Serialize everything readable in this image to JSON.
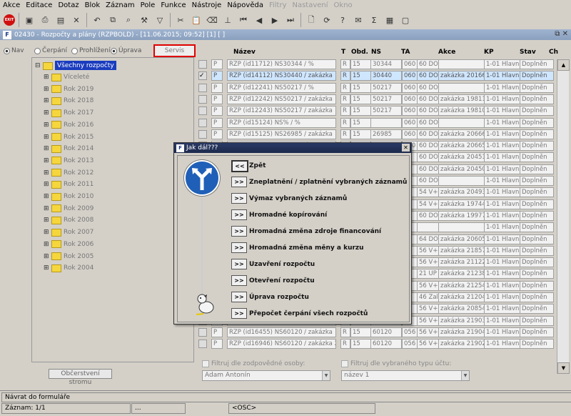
{
  "menu": {
    "items": [
      "Akce",
      "Editace",
      "Dotaz",
      "Blok",
      "Záznam",
      "Pole",
      "Funkce",
      "Nástroje",
      "Nápověda",
      "Filtry",
      "Nastavení",
      "Okno"
    ]
  },
  "toolbar": {
    "exit_label": "EXIT"
  },
  "window": {
    "title": "02430 - Rozpočty a plány (RZPBOLD) - [11.06.2015; 09:52]  [1]  [ ]",
    "logo": "F"
  },
  "left": {
    "radios": [
      "Nav",
      "Čerpání",
      "Prohlížení",
      "Úprava"
    ],
    "servis_label": "Servis",
    "tree_root": "Všechny rozpočty",
    "tree_items": [
      "Víceleté",
      "Rok 2019",
      "Rok 2018",
      "Rok 2017",
      "Rok 2016",
      "Rok 2015",
      "Rok 2014",
      "Rok 2013",
      "Rok 2012",
      "Rok 2011",
      "Rok 2010",
      "Rok 2009",
      "Rok 2008",
      "Rok 2007",
      "Rok 2006",
      "Rok 2005",
      "Rok 2004"
    ],
    "refresh_label": "Občerstvení stromu"
  },
  "grid": {
    "headers": [
      "Název",
      "T",
      "Obd.",
      "NS",
      "TA",
      "Akce",
      "KP",
      "Stav",
      "Ch"
    ],
    "rows": [
      {
        "p": "P",
        "nazev": "RZP (id11712) NS30344 / %",
        "t": "R",
        "obd": "15",
        "ns": "30344",
        "ta": "060",
        "ta2": "60 DO",
        "akce": "",
        "kp": "1-01 Hlavní",
        "stav": "Doplněn"
      },
      {
        "p": "P",
        "nazev": "RZP (id14112) NS30440 / zakázka",
        "t": "R",
        "obd": "15",
        "ns": "30440",
        "ta": "060",
        "ta2": "60 DO",
        "akce": "zakázka 20166",
        "kp": "1-01 Hlavní",
        "stav": "Doplněn"
      },
      {
        "p": "P",
        "nazev": "RZP (id12241) NS50217 / %",
        "t": "R",
        "obd": "15",
        "ns": "50217",
        "ta": "060",
        "ta2": "60 DO",
        "akce": "",
        "kp": "1-01 Hlavní",
        "stav": "Doplněn"
      },
      {
        "p": "P",
        "nazev": "RZP (id12242) NS50217 / zakázka",
        "t": "R",
        "obd": "15",
        "ns": "50217",
        "ta": "060",
        "ta2": "60 DO",
        "akce": "zakázka 19811",
        "kp": "1-01 Hlavní",
        "stav": "Doplněn"
      },
      {
        "p": "P",
        "nazev": "RZP (id12243) NS50217 / zakázka",
        "t": "R",
        "obd": "15",
        "ns": "50217",
        "ta": "060",
        "ta2": "60 DO",
        "akce": "zakázka 19810",
        "kp": "1-01 Hlavní",
        "stav": "Doplněn"
      },
      {
        "p": "P",
        "nazev": "RZP (id15124) NS% / %",
        "t": "R",
        "obd": "15",
        "ns": "",
        "ta": "060",
        "ta2": "60 DO",
        "akce": "",
        "kp": "1-01 Hlavní",
        "stav": "Doplněn"
      },
      {
        "p": "P",
        "nazev": "RZP (id15125) NS26985 / zakázka",
        "t": "R",
        "obd": "15",
        "ns": "26985",
        "ta": "060",
        "ta2": "60 DO",
        "akce": "zakázka 20666",
        "kp": "1-01 Hlavní",
        "stav": "Doplněn"
      },
      {
        "p": "P",
        "nazev": "RZP (id15126) NS% / zakázka 206",
        "t": "R",
        "obd": "15",
        "ns": "",
        "ta": "060",
        "ta2": "60 DO",
        "akce": "zakázka 20665",
        "kp": "1-01 Hlavní",
        "stav": "Doplněn"
      },
      {
        "p": "",
        "nazev": "",
        "t": "",
        "obd": "",
        "ns": "",
        "ta": "",
        "ta2": "60 DO",
        "akce": "zakázka 20451",
        "kp": "1-01 Hlavní",
        "stav": "Doplněn"
      },
      {
        "p": "",
        "nazev": "",
        "t": "",
        "obd": "",
        "ns": "",
        "ta": "",
        "ta2": "60 DO",
        "akce": "zakázka 20450",
        "kp": "1-01 Hlavní",
        "stav": "Doplněn"
      },
      {
        "p": "",
        "nazev": "",
        "t": "",
        "obd": "",
        "ns": "",
        "ta": "",
        "ta2": "60 DO",
        "akce": "",
        "kp": "1-01 Hlavní",
        "stav": "Doplněn"
      },
      {
        "p": "",
        "nazev": "",
        "t": "",
        "obd": "",
        "ns": "",
        "ta": "",
        "ta2": "54 V+",
        "akce": "zakázka 20493",
        "kp": "1-01 Hlavní",
        "stav": "Doplněn"
      },
      {
        "p": "",
        "nazev": "",
        "t": "",
        "obd": "",
        "ns": "",
        "ta": "",
        "ta2": "54 V+",
        "akce": "zakázka 19744",
        "kp": "1-01 Hlavní",
        "stav": "Doplněn"
      },
      {
        "p": "",
        "nazev": "",
        "t": "",
        "obd": "",
        "ns": "",
        "ta": "",
        "ta2": "60 DO",
        "akce": "zakázka 19977",
        "kp": "1-01 Hlavní",
        "stav": "Doplněn"
      },
      {
        "p": "",
        "nazev": "",
        "t": "",
        "obd": "",
        "ns": "",
        "ta": "",
        "ta2": "",
        "akce": "",
        "kp": "1-01 Hlavní",
        "stav": "Doplněn"
      },
      {
        "p": "",
        "nazev": "",
        "t": "",
        "obd": "",
        "ns": "",
        "ta": "",
        "ta2": "64 DO",
        "akce": "zakázka 20605",
        "kp": "1-01 Hlavní",
        "stav": "Doplněn"
      },
      {
        "p": "",
        "nazev": "",
        "t": "",
        "obd": "",
        "ns": "",
        "ta": "",
        "ta2": "56 V+",
        "akce": "zakázka 21857",
        "kp": "1-01 Hlavní",
        "stav": "Doplněn"
      },
      {
        "p": "",
        "nazev": "",
        "t": "",
        "obd": "",
        "ns": "",
        "ta": "",
        "ta2": "56 V+",
        "akce": "zakázka 21122",
        "kp": "1-01 Hlavní",
        "stav": "Doplněn"
      },
      {
        "p": "",
        "nazev": "",
        "t": "",
        "obd": "",
        "ns": "",
        "ta": "",
        "ta2": "21 UP",
        "akce": "zakázka 21238",
        "kp": "1-01 Hlavní",
        "stav": "Doplněn"
      },
      {
        "p": "",
        "nazev": "",
        "t": "",
        "obd": "",
        "ns": "",
        "ta": "",
        "ta2": "56 V+",
        "akce": "zakázka 21254",
        "kp": "1-01 Hlavní",
        "stav": "Doplněn"
      },
      {
        "p": "",
        "nazev": "",
        "t": "",
        "obd": "",
        "ns": "",
        "ta": "",
        "ta2": "46 Zal",
        "akce": "zakázka 21204",
        "kp": "1-01 Hlavní",
        "stav": "Doplněn"
      },
      {
        "p": "",
        "nazev": "",
        "t": "",
        "obd": "",
        "ns": "",
        "ta": "",
        "ta2": "56 V+",
        "akce": "zakázka 20854",
        "kp": "1-01 Hlavní",
        "stav": "Doplněn"
      },
      {
        "p": "",
        "nazev": "",
        "t": "",
        "obd": "",
        "ns": "",
        "ta": "",
        "ta2": "56 V+",
        "akce": "zakázka 21903",
        "kp": "1-01 Hlavní",
        "stav": "Doplněn"
      },
      {
        "p": "P",
        "nazev": "RZP (id16455) NS60120 / zakázka",
        "t": "R",
        "obd": "15",
        "ns": "60120",
        "ta": "056",
        "ta2": "56 V+",
        "akce": "zakázka 21904",
        "kp": "1-01 Hlavní",
        "stav": "Doplněn"
      },
      {
        "p": "P",
        "nazev": "RZP (id16946) NS60120 / zakázka 2",
        "t": "R",
        "obd": "15",
        "ns": "60120",
        "ta": "056",
        "ta2": "56 V+",
        "akce": "zakázka 21902",
        "kp": "1-01 Hlavní",
        "stav": "Doplněn"
      }
    ]
  },
  "filters": {
    "osoby_label": "Filtruj dle zodpovědné osoby:",
    "osoby_value": "Adam Antonín",
    "ucet_label": "Filtruj dle vybraného typu účtu:",
    "ucet_value": "název 1"
  },
  "dialog": {
    "title": "Jak dál???",
    "back_btn": "<<",
    "back_label": "Zpět",
    "go_btn": ">>",
    "actions": [
      "Zneplatnění / zplatnění vybraných záznamů",
      "Výmaz vybraných záznamů",
      "Hromadné kopírování",
      "Hromadná změna zdroje financování",
      "Hromadná změna měny a kurzu",
      "Uzavření rozpočtu",
      "Otevření rozpočtu",
      "Úprava rozpočtu",
      "Přepočet čerpání všech rozpočtů"
    ]
  },
  "status": {
    "message": "Návrat do formuláře",
    "record": "Záznam: 1/1",
    "dots": "...",
    "osc": "<OSC>"
  }
}
